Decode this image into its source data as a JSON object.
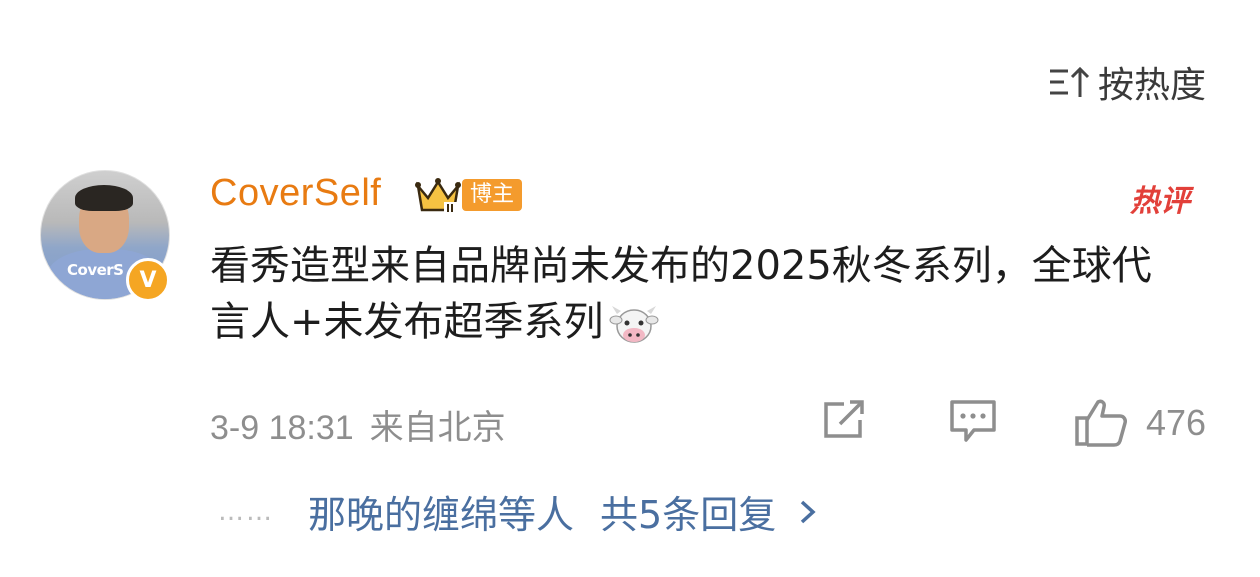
{
  "sort": {
    "icon": "sort-hot-icon",
    "label": "按热度"
  },
  "comment": {
    "avatar_text": "CoverS",
    "verified_badge": "V",
    "username": "CoverSelf",
    "level_icon": "crown-level-icon",
    "role_badge": "博主",
    "hot_badge": "热评",
    "text": "看秀造型来自品牌尚未发布的2025秋冬系列，全球代言人+未发布超季系列",
    "emoji": "cow-emoji",
    "date": "3-9 18:31",
    "location": "来自北京",
    "like_count": "476"
  },
  "replies": {
    "dots": "……",
    "users": "那晚的缠绵",
    "suffix": "等人",
    "count_text": "共5条回复"
  },
  "colors": {
    "username": "#e87b12",
    "badge": "#f49b2d",
    "hot": "#e2403a",
    "link": "#4a6fa0",
    "meta": "#8e8e8e"
  }
}
